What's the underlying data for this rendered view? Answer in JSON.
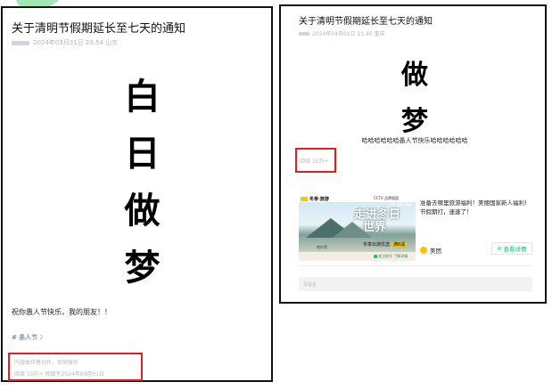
{
  "left": {
    "title": "关于清明节假期延长至七天的通知",
    "meta": "2024年03月31日 23:54 山东",
    "big_chars": [
      "白",
      "日",
      "做",
      "梦"
    ],
    "greeting": "祝你愚人节快乐，我的朋友！！",
    "tag": "# 愚人节",
    "tag_count": "2",
    "disclaimer": "内容由作者创作，仅供娱乐",
    "stats": "阅读 10万+   修改于2024年04月01日"
  },
  "right": {
    "title": "关于清明节假期延长至七天的通知",
    "meta": "2024年04月01日 11:40 重庆",
    "big_chars": [
      "做",
      "梦"
    ],
    "greeting": "哈哈哈哈哈哈愚人节快乐哈哈哈哈哈哈",
    "views": "阅读 10万+",
    "ad": {
      "logo": "冬季·旅游",
      "brand": "CCTV 品牌强国",
      "headline_line1": "走进冬日",
      "headline_line2": "世界",
      "tags": "冰雪·温泉·民俗",
      "sub": "冬季出游优选",
      "sub_highlight": "满8减",
      "city": "哈尔滨",
      "cta": "关注账号 了解详情",
      "description": "准备去哪里旅游福利！美丽国家新人福利！节假期打，速速了！",
      "advertiser": "美团",
      "button_label": "查看详情"
    },
    "comment_placeholder": "写留言"
  },
  "colors": {
    "highlight_box": "#e02020",
    "accent_green": "#07c160",
    "link_blue": "#586c94",
    "meta_gray": "#b5b5b5"
  }
}
